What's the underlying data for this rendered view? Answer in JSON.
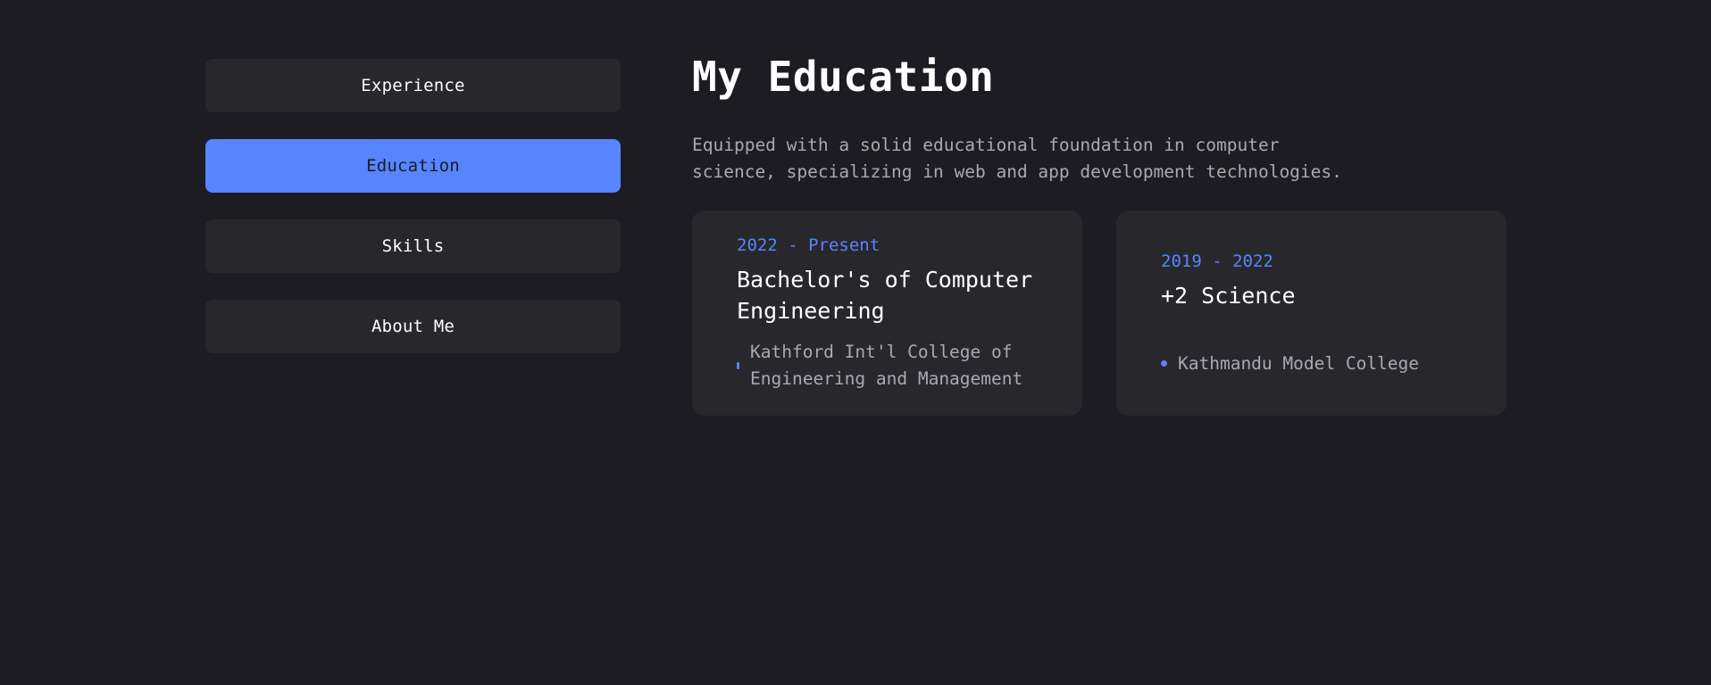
{
  "tabs": [
    {
      "label": "Experience",
      "active": false
    },
    {
      "label": "Education",
      "active": true
    },
    {
      "label": "Skills",
      "active": false
    },
    {
      "label": "About Me",
      "active": false
    }
  ],
  "section": {
    "title": "My Education",
    "description": "Equipped with a solid educational foundation in computer science, specializing in web and app development technologies."
  },
  "education": [
    {
      "period": "2022 - Present",
      "degree": "Bachelor's of Computer Engineering",
      "institution": "Kathford Int'l College of Engineering and Management"
    },
    {
      "period": "2019 - 2022",
      "degree": "+2 Science",
      "institution": "Kathmandu Model College"
    }
  ],
  "colors": {
    "background": "#1c1c22",
    "surface": "#27272c",
    "accent": "#5785ff",
    "muted_text": "#a9a9b2"
  }
}
